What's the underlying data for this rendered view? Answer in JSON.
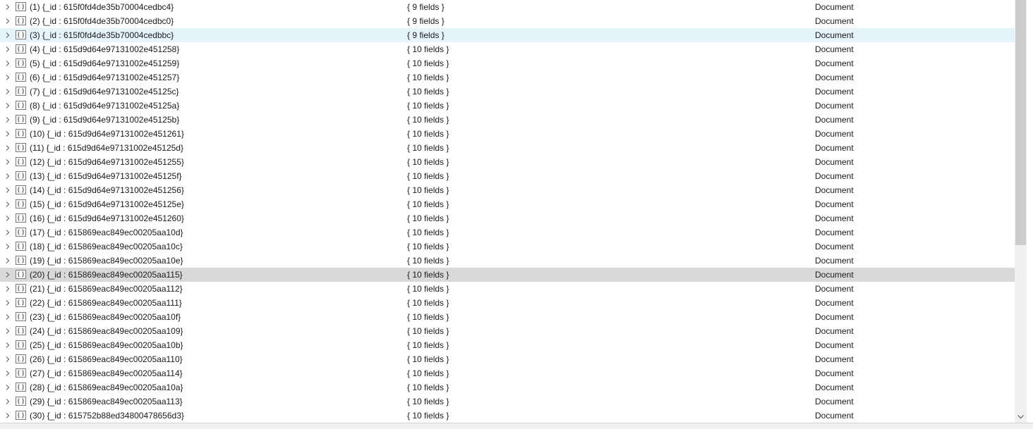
{
  "rows": [
    {
      "key": "(1) {_id : 615f0fd4de35b70004cedbc4}",
      "value": "{ 9 fields }",
      "type": "Document"
    },
    {
      "key": "(2) {_id : 615f0fd4de35b70004cedbc0}",
      "value": "{ 9 fields }",
      "type": "Document"
    },
    {
      "key": "(3) {_id : 615f0fd4de35b70004cedbbc}",
      "value": "{ 9 fields }",
      "type": "Document"
    },
    {
      "key": "(4) {_id : 615d9d64e97131002e451258}",
      "value": "{ 10 fields }",
      "type": "Document"
    },
    {
      "key": "(5) {_id : 615d9d64e97131002e451259}",
      "value": "{ 10 fields }",
      "type": "Document"
    },
    {
      "key": "(6) {_id : 615d9d64e97131002e451257}",
      "value": "{ 10 fields }",
      "type": "Document"
    },
    {
      "key": "(7) {_id : 615d9d64e97131002e45125c}",
      "value": "{ 10 fields }",
      "type": "Document"
    },
    {
      "key": "(8) {_id : 615d9d64e97131002e45125a}",
      "value": "{ 10 fields }",
      "type": "Document"
    },
    {
      "key": "(9) {_id : 615d9d64e97131002e45125b}",
      "value": "{ 10 fields }",
      "type": "Document"
    },
    {
      "key": "(10) {_id : 615d9d64e97131002e451261}",
      "value": "{ 10 fields }",
      "type": "Document"
    },
    {
      "key": "(11) {_id : 615d9d64e97131002e45125d}",
      "value": "{ 10 fields }",
      "type": "Document"
    },
    {
      "key": "(12) {_id : 615d9d64e97131002e451255}",
      "value": "{ 10 fields }",
      "type": "Document"
    },
    {
      "key": "(13) {_id : 615d9d64e97131002e45125f}",
      "value": "{ 10 fields }",
      "type": "Document"
    },
    {
      "key": "(14) {_id : 615d9d64e97131002e451256}",
      "value": "{ 10 fields }",
      "type": "Document"
    },
    {
      "key": "(15) {_id : 615d9d64e97131002e45125e}",
      "value": "{ 10 fields }",
      "type": "Document"
    },
    {
      "key": "(16) {_id : 615d9d64e97131002e451260}",
      "value": "{ 10 fields }",
      "type": "Document"
    },
    {
      "key": "(17) {_id : 615869eac849ec00205aa10d}",
      "value": "{ 10 fields }",
      "type": "Document"
    },
    {
      "key": "(18) {_id : 615869eac849ec00205aa10c}",
      "value": "{ 10 fields }",
      "type": "Document"
    },
    {
      "key": "(19) {_id : 615869eac849ec00205aa10e}",
      "value": "{ 10 fields }",
      "type": "Document"
    },
    {
      "key": "(20) {_id : 615869eac849ec00205aa115}",
      "value": "{ 10 fields }",
      "type": "Document"
    },
    {
      "key": "(21) {_id : 615869eac849ec00205aa112}",
      "value": "{ 10 fields }",
      "type": "Document"
    },
    {
      "key": "(22) {_id : 615869eac849ec00205aa111}",
      "value": "{ 10 fields }",
      "type": "Document"
    },
    {
      "key": "(23) {_id : 615869eac849ec00205aa10f}",
      "value": "{ 10 fields }",
      "type": "Document"
    },
    {
      "key": "(24) {_id : 615869eac849ec00205aa109}",
      "value": "{ 10 fields }",
      "type": "Document"
    },
    {
      "key": "(25) {_id : 615869eac849ec00205aa10b}",
      "value": "{ 10 fields }",
      "type": "Document"
    },
    {
      "key": "(26) {_id : 615869eac849ec00205aa110}",
      "value": "{ 10 fields }",
      "type": "Document"
    },
    {
      "key": "(27) {_id : 615869eac849ec00205aa114}",
      "value": "{ 10 fields }",
      "type": "Document"
    },
    {
      "key": "(28) {_id : 615869eac849ec00205aa10a}",
      "value": "{ 10 fields }",
      "type": "Document"
    },
    {
      "key": "(29) {_id : 615869eac849ec00205aa113}",
      "value": "{ 10 fields }",
      "type": "Document"
    },
    {
      "key": "(30) {_id : 615752b88ed34800478656d3}",
      "value": "{ 10 fields }",
      "type": "Document"
    }
  ],
  "hovered_row": 3,
  "selected_row": 20,
  "row_icons": {
    "expand": "chevron-right-icon",
    "node": "document-braces-icon"
  },
  "colors": {
    "hover": "#e5f3fb",
    "selected": "#d9d9d9",
    "scroll_thumb": "#cdcdcd"
  }
}
